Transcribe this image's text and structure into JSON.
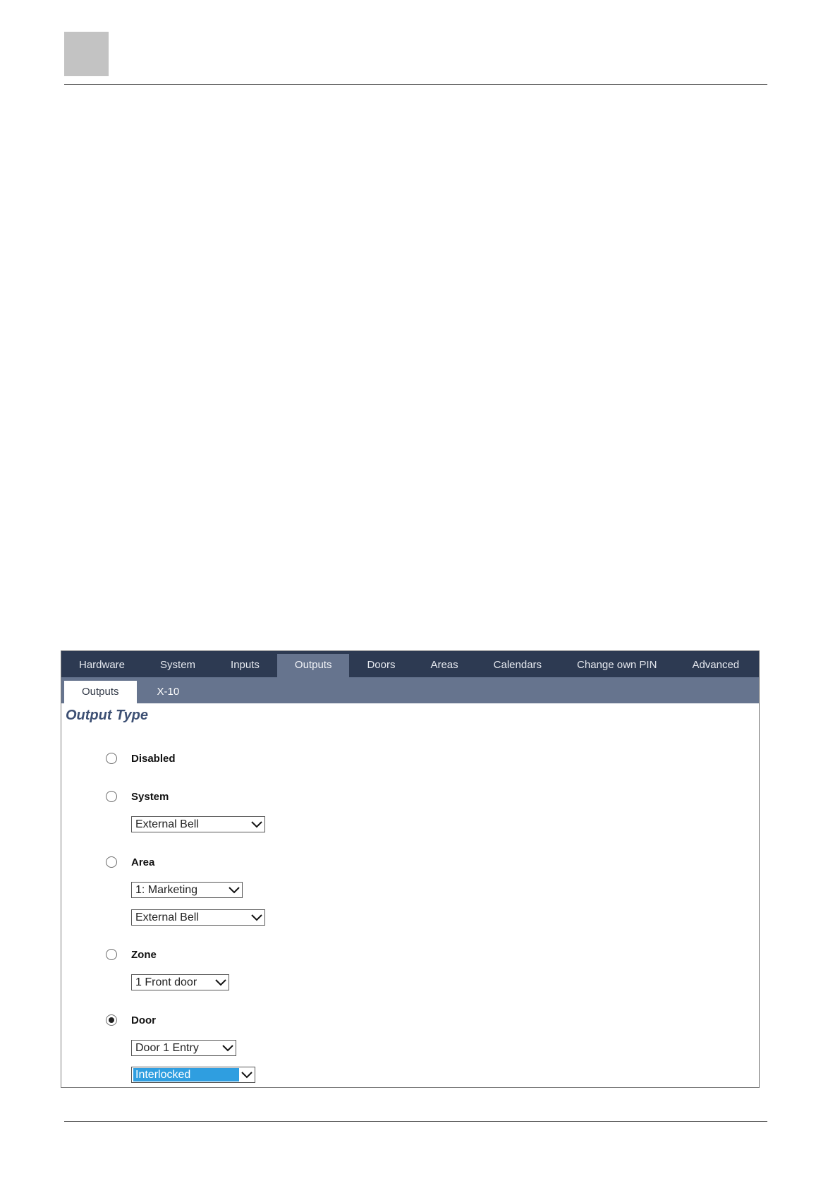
{
  "nav": {
    "tabs": [
      "Hardware",
      "System",
      "Inputs",
      "Outputs",
      "Doors",
      "Areas",
      "Calendars",
      "Change own PIN",
      "Advanced"
    ],
    "active": "Outputs"
  },
  "subnav": {
    "tabs": [
      "Outputs",
      "X-10"
    ],
    "active": "Outputs"
  },
  "form": {
    "title": "Output Type",
    "disabled_label": "Disabled",
    "system_label": "System",
    "system_value": "External Bell",
    "area_label": "Area",
    "area_value": "1: Marketing",
    "area_bell_value": "External Bell",
    "zone_label": "Zone",
    "zone_value": "1 Front door",
    "door_label": "Door",
    "door_value": "Door 1 Entry",
    "door_mode_value": "Interlocked",
    "selected_option": "Door"
  },
  "colors": {
    "nav_bg": "#2d3a52",
    "subnav_bg": "#66748e",
    "title_color": "#3c4f73",
    "highlight": "#2f9ee0"
  }
}
